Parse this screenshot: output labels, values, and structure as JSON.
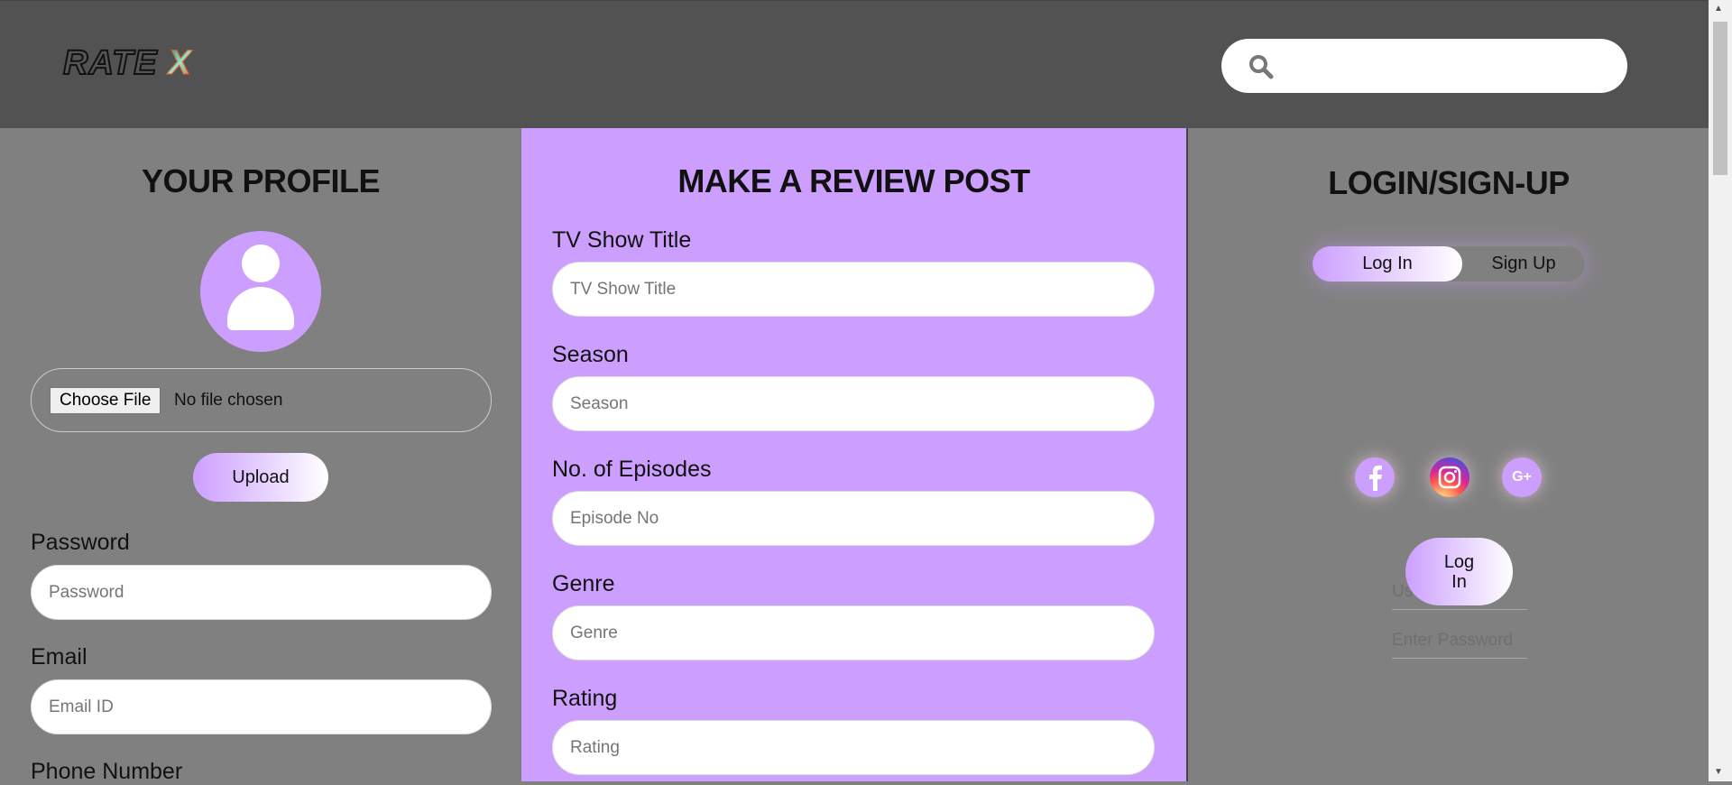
{
  "header": {
    "logo_text": "RATE",
    "logo_x": "X",
    "search_placeholder": ""
  },
  "profile": {
    "title": "YOUR PROFILE",
    "choose_file": "Choose File",
    "no_file": "No file chosen",
    "upload": "Upload",
    "fields": [
      {
        "label": "Password",
        "placeholder": "Password"
      },
      {
        "label": "Email",
        "placeholder": "Email ID"
      },
      {
        "label": "Phone Number"
      }
    ]
  },
  "review": {
    "title": "MAKE A REVIEW POST",
    "fields": [
      {
        "label": "TV Show Title",
        "placeholder": "TV Show Title"
      },
      {
        "label": "Season",
        "placeholder": "Season"
      },
      {
        "label": "No. of Episodes",
        "placeholder": "Episode No"
      },
      {
        "label": "Genre",
        "placeholder": "Genre"
      },
      {
        "label": "Rating",
        "placeholder": "Rating"
      }
    ]
  },
  "login": {
    "title": "LOGIN/SIGN-UP",
    "tab_login": "Log In",
    "tab_signup": "Sign Up",
    "user_placeholder": "User Id",
    "password_placeholder": "Enter Password",
    "submit": "Log In",
    "google_label": "G+"
  }
}
